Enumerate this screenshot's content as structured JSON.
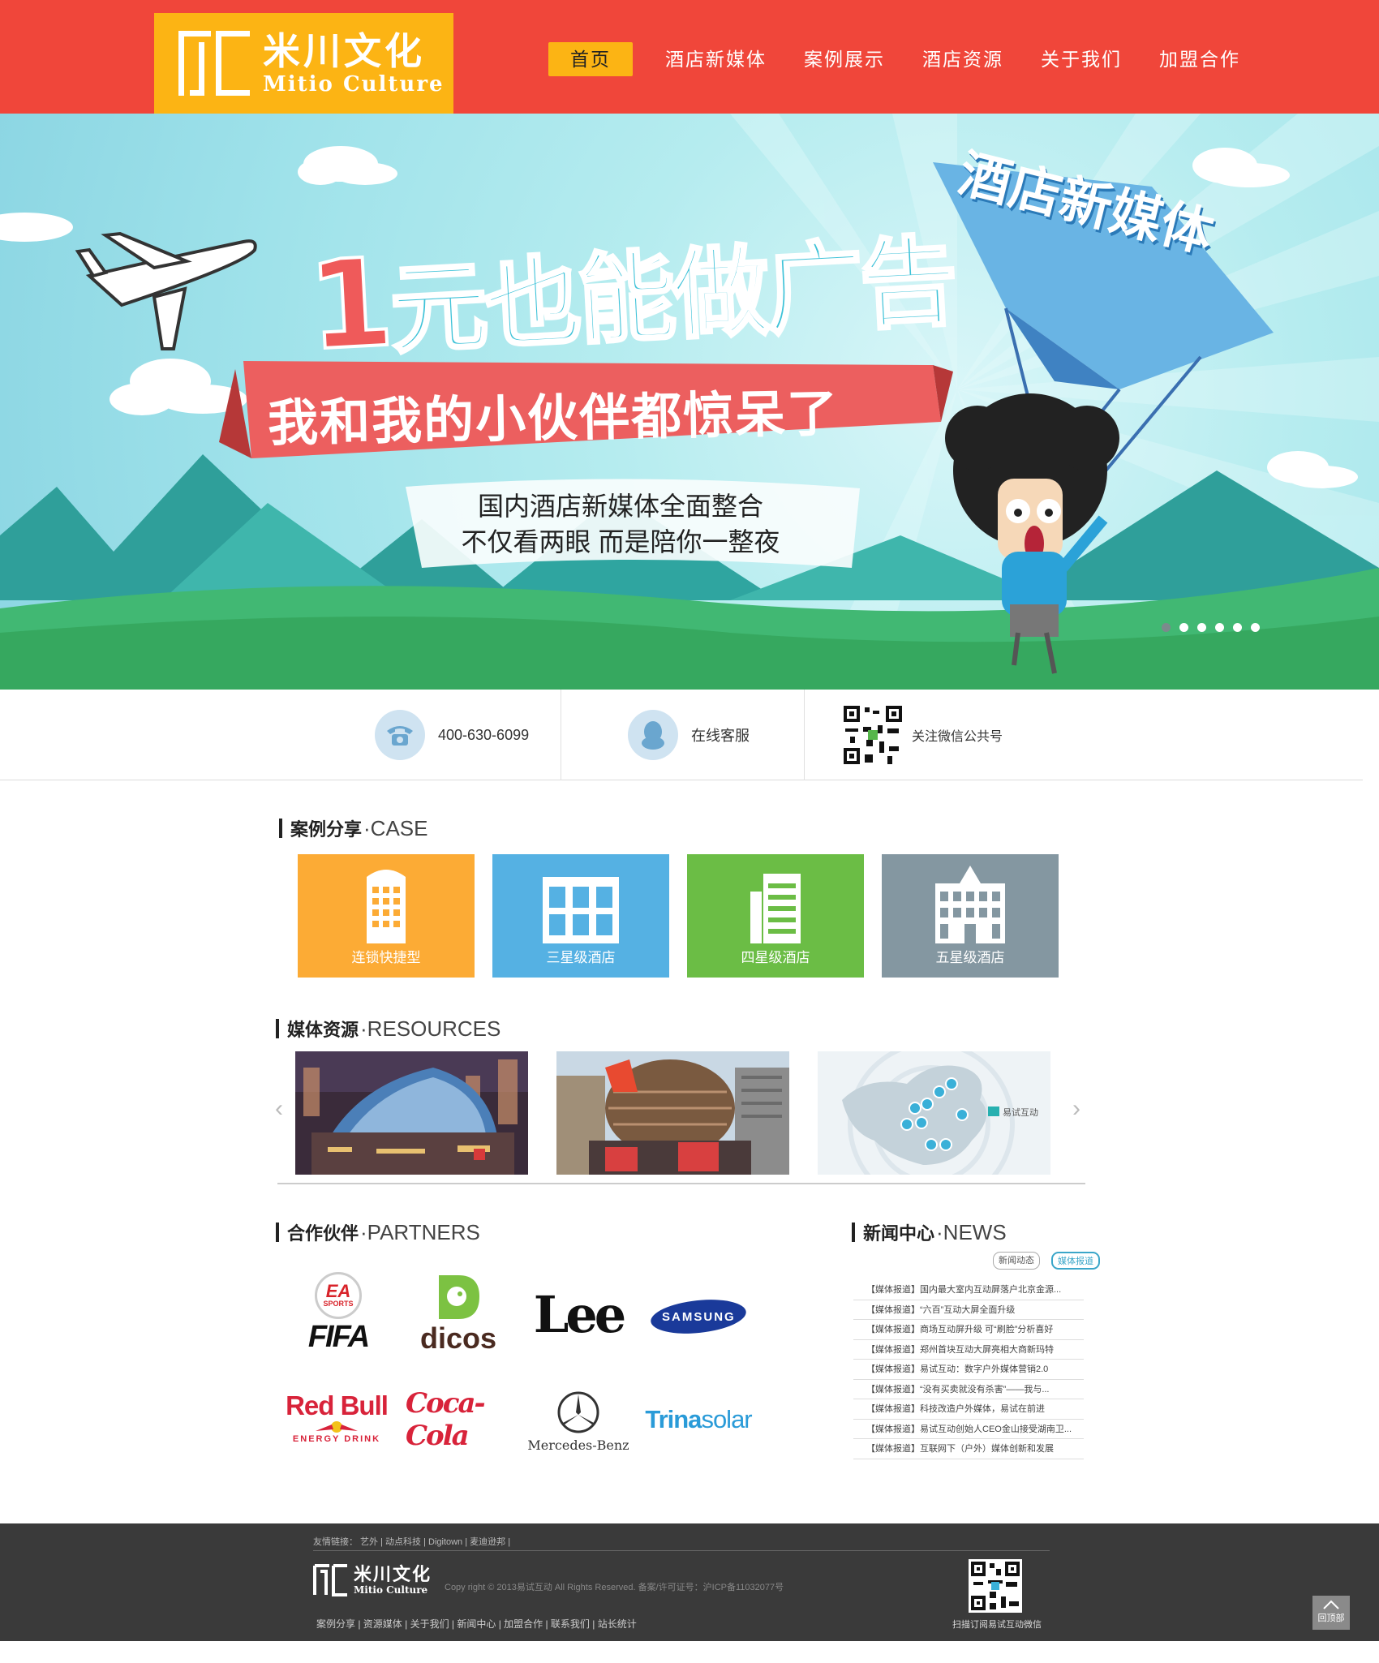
{
  "logo": {
    "cn": "米川文化",
    "en": "Mitio Culture"
  },
  "nav": [
    {
      "label": "首页",
      "active": true
    },
    {
      "label": "酒店新媒体"
    },
    {
      "label": "案例展示"
    },
    {
      "label": "酒店资源"
    },
    {
      "label": "关于我们"
    },
    {
      "label": "加盟合作"
    }
  ],
  "banner": {
    "kite_text": "酒店新媒体",
    "headline_number": "1",
    "headline_rest": "元也能做广告",
    "ribbon": "我和我的小伙伴都惊呆了",
    "sub_line1": "国内酒店新媒体全面整合",
    "sub_line2": "不仅看两眼 而是陪你一整夜",
    "slides": 6,
    "active_slide": 1
  },
  "contact": {
    "phone": "400-630-6099",
    "online": "在线客服",
    "wechat": "关注微信公共号"
  },
  "case": {
    "title_cn": "案例分享",
    "title_en": "·CASE",
    "tiles": [
      {
        "label": "连锁快捷型",
        "color": "#fcab35"
      },
      {
        "label": "三星级酒店",
        "color": "#55b1e3"
      },
      {
        "label": "四星级酒店",
        "color": "#6bbd45"
      },
      {
        "label": "五星级酒店",
        "color": "#8497a1"
      }
    ]
  },
  "resources": {
    "title_cn": "媒体资源",
    "title_en": "·RESOURCES",
    "prev": "‹",
    "next": "›",
    "map_brand": "易试互动"
  },
  "partners": {
    "title_cn": "合作伙伴",
    "title_en": "·PARTNERS",
    "items": {
      "ea": "EA",
      "ea_sub": "SPORTS",
      "fifa": "FIFA",
      "dicos": "dicos",
      "lee": "Lee",
      "samsung": "SAMSUNG",
      "redbull": "Red Bull",
      "redbull_sub": "ENERGY DRINK",
      "cocacola": "Coca-Cola",
      "mercedes": "Mercedes-Benz",
      "trina": "Trina",
      "trina_rest": "solar"
    }
  },
  "news": {
    "title_cn": "新闻中心",
    "title_en": "·NEWS",
    "tabs": [
      "新闻动态",
      "媒体报道"
    ],
    "items": [
      "【媒体报道】国内最大室内互动屏落户北京金源...",
      "【媒体报道】“六百”互动大屏全面升级",
      "【媒体报道】商场互动屏升级 可“刷脸”分析喜好",
      "【媒体报道】郑州首块互动大屏亮相大商新玛特",
      "【媒体报道】易试互动：数字户外媒体营销2.0",
      "【媒体报道】“没有买卖就没有杀害”——我与...",
      "【媒体报道】科技改造户外媒体，易试在前进",
      "【媒体报道】易试互动创始人CEO金山接受湖南卫...",
      "【媒体报道】互联网下（户外）媒体创新和发展"
    ]
  },
  "footer": {
    "links_top": "友情链接：  艺外 | 动点科技 | Digitown | 麦迪逊邦 |",
    "copyright": "Copy right © 2013易试互动 All Rights Reserved.    备案/许可证号：沪ICP备11032077号",
    "links_bottom": "案例分享 | 资源媒体 | 关于我们 | 新闻中心 | 加盟合作 | 联系我们 | 站长统计",
    "qr_label": "扫描订阅易试互动微信",
    "back_top": "回顶部"
  },
  "colors": {
    "header": "#f0463a",
    "accent": "#fcb414",
    "footer": "#3a3a3a"
  }
}
